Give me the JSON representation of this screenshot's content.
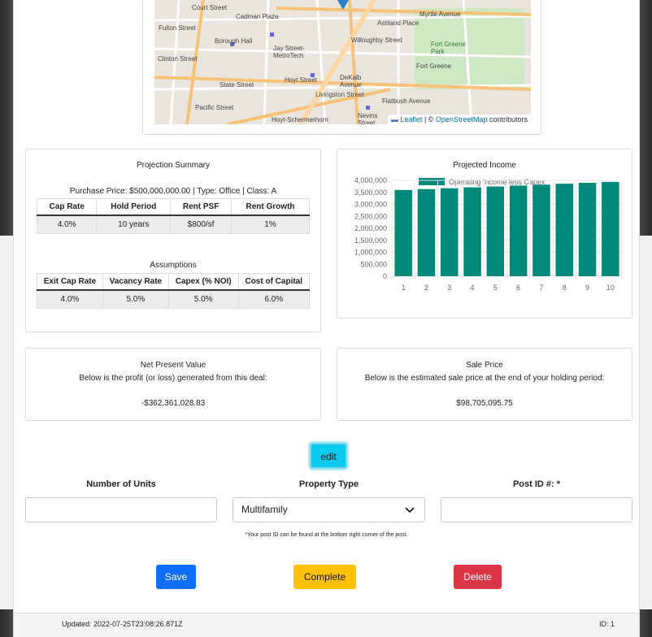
{
  "map": {
    "labels": [
      "Court Street",
      "Borough Hall",
      "Jay Street-MetroTech",
      "Hoyt Street",
      "DeKalb Avenue",
      "Fort Greene",
      "Fort Greene Park",
      "Myrtle Avenue",
      "Nevins Street",
      "Hoyt-Schermerhorn",
      "State Street",
      "Pacific Street",
      "Fulton Street",
      "Livingston Street",
      "Willoughby Street",
      "Ashland Place",
      "Flatbush Avenue",
      "Cadman Plaza",
      "Clinton Street"
    ],
    "attribution_leaflet": "Leaflet",
    "attribution_sep": " | © ",
    "attribution_osm": "OpenStreetMap",
    "attribution_tail": " contributors"
  },
  "projection": {
    "title": "Projection Summary",
    "subtitle": "Purchase Price: $500,000,000.00 | Type: Office | Class: A",
    "headers": [
      "Cap Rate",
      "Hold Period",
      "Rent PSF",
      "Rent Growth"
    ],
    "values": [
      "4.0%",
      "10 years",
      "$800/sf",
      "1%"
    ],
    "assumptions_title": "Assumptions",
    "assumption_headers": [
      "Exit Cap Rate",
      "Vacancy Rate",
      "Capex (% NOI)",
      "Cost of Capital"
    ],
    "assumption_values": [
      "4.0%",
      "5.0%",
      "5.0%",
      "6.0%"
    ]
  },
  "chart_data": {
    "type": "bar",
    "title": "Projected Income",
    "categories": [
      "1",
      "2",
      "3",
      "4",
      "5",
      "6",
      "7",
      "8",
      "9",
      "10"
    ],
    "series": [
      {
        "name": "Operating Income less Capex",
        "values": [
          3600000,
          3636000,
          3672000,
          3709000,
          3746000,
          3783000,
          3821000,
          3859000,
          3898000,
          3937000
        ]
      }
    ],
    "ylim": [
      0,
      4000000
    ],
    "yticks": [
      "4,000,000",
      "3,500,000",
      "3,000,000",
      "2,500,000",
      "2,000,000",
      "1,500,000",
      "1,000,000",
      "500,000",
      "0"
    ],
    "bar_color": "#00897b",
    "legend_position": "top"
  },
  "npv": {
    "title": "Net Present Value",
    "desc": "Below is the profit (or loss) generated from this deal:",
    "value": "-$362,361,028.83"
  },
  "sale": {
    "title": "Sale Price",
    "desc": "Below is the estimated sale price at the end of your holding period:",
    "value": "$98,705,095.75"
  },
  "form": {
    "edit_label": "edit",
    "units_label": "Number of Units",
    "units_value": "",
    "type_label": "Property Type",
    "type_value": "Multifamily",
    "postid_label": "Post ID #: *",
    "postid_value": "",
    "hint": "*Your post ID can be found at the bottom right corner of the post.",
    "save": "Save",
    "complete": "Complete",
    "delete": "Delete"
  },
  "colors": {
    "save": "#0d6efd",
    "complete": "#ffc107",
    "delete": "#dc3545",
    "edit": "#0dcaf0"
  },
  "footer": {
    "updated": "Updated: 2022-07-25T23:08:26.871Z",
    "id": "ID: 1"
  }
}
